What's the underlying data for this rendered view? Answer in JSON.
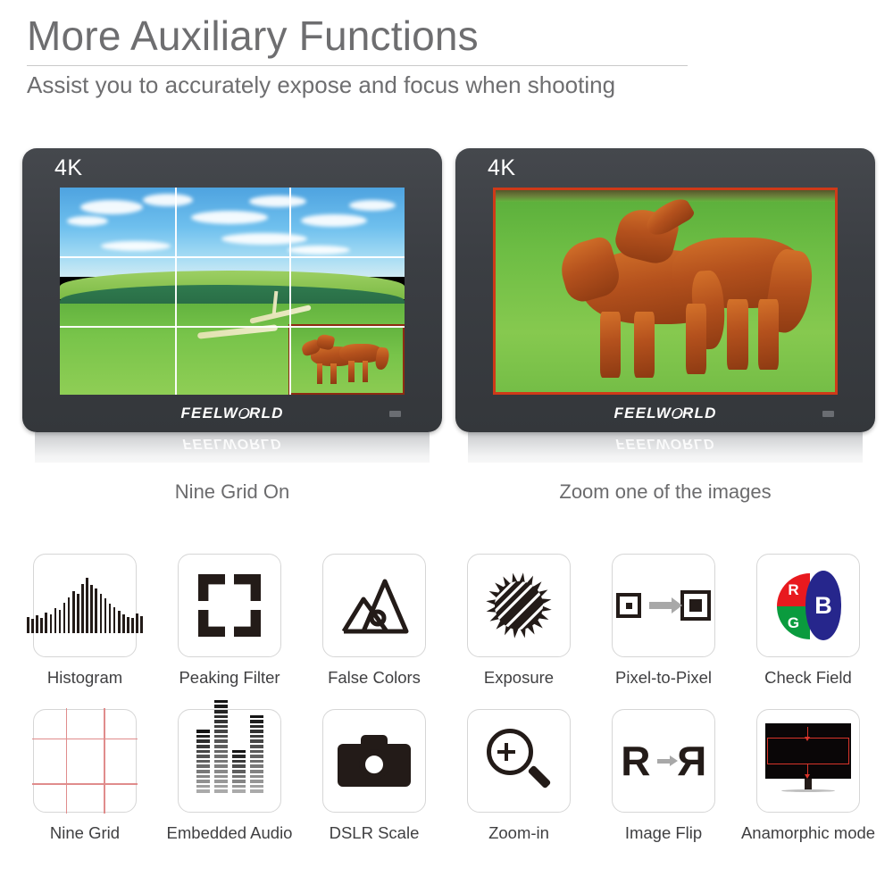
{
  "header": {
    "title": "More Auxiliary Functions",
    "subtitle": "Assist you to accurately expose and focus when shooting"
  },
  "monitors": [
    {
      "badge": "4K",
      "brand": "FEELWORLD",
      "caption": "Nine Grid On",
      "screen_mode": "nine-grid",
      "overlay_color": "#ffffff",
      "inset_border_color": "#8e2b12"
    },
    {
      "badge": "4K",
      "brand": "FEELWORLD",
      "caption": "Zoom one of the images",
      "screen_mode": "zoomed",
      "frame_color": "#cf3a18"
    }
  ],
  "features": {
    "row1": [
      {
        "icon": "histogram-icon",
        "label": "Histogram"
      },
      {
        "icon": "peaking-filter-icon",
        "label": "Peaking Filter"
      },
      {
        "icon": "false-colors-icon",
        "label": "False Colors"
      },
      {
        "icon": "exposure-icon",
        "label": "Exposure"
      },
      {
        "icon": "pixel-to-pixel-icon",
        "label": "Pixel-to-Pixel"
      },
      {
        "icon": "check-field-icon",
        "label": "Check Field"
      }
    ],
    "row2": [
      {
        "icon": "nine-grid-icon",
        "label": "Nine Grid"
      },
      {
        "icon": "embedded-audio-icon",
        "label": "Embedded  Audio"
      },
      {
        "icon": "dslr-scale-icon",
        "label": "DSLR Scale"
      },
      {
        "icon": "zoom-in-icon",
        "label": "Zoom-in"
      },
      {
        "icon": "image-flip-icon",
        "label": "Image Flip"
      },
      {
        "icon": "anamorphic-mode-icon",
        "label": "Anamorphic mode"
      }
    ]
  },
  "check_field_letters": {
    "r": "R",
    "g": "G",
    "b": "B"
  },
  "image_flip_letters": {
    "normal": "R",
    "mirrored": "R"
  },
  "colors": {
    "title_gray": "#6e6e70",
    "label_dark": "#3f3f41",
    "bezel": "#3b3e43",
    "tile_border": "#d6d6d6",
    "red": "#e8191e",
    "green": "#0a9b3e",
    "blue": "#26268c",
    "grid_red": "#e08c8c",
    "ink": "#231b18"
  }
}
